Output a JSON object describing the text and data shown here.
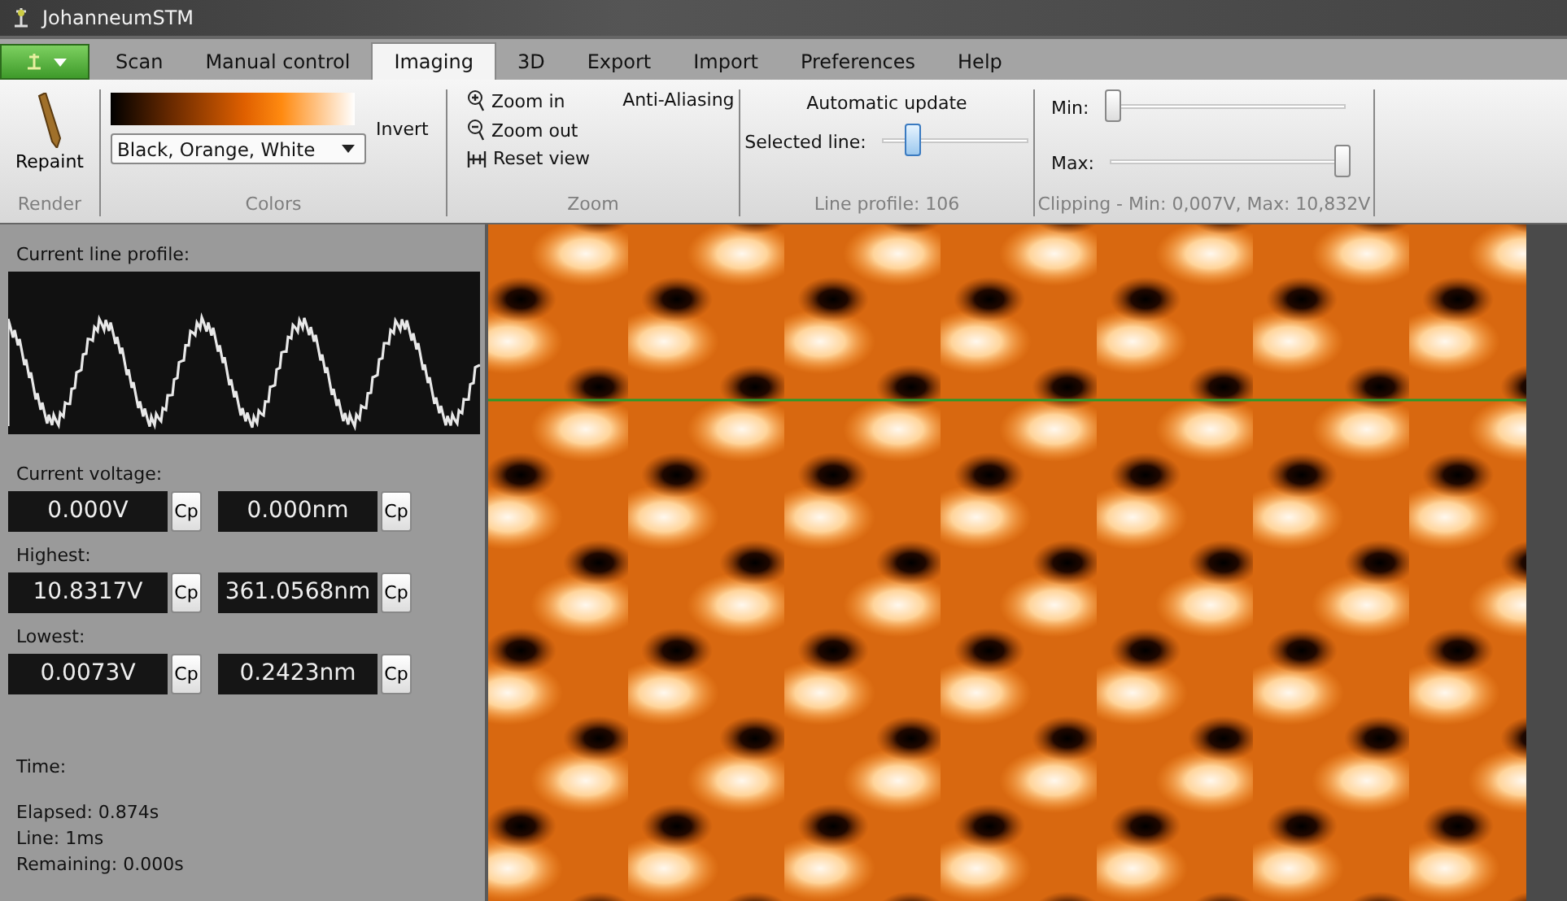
{
  "window": {
    "title": "JohanneumSTM"
  },
  "tabs": [
    {
      "label": "Scan",
      "selected": false
    },
    {
      "label": "Manual control",
      "selected": false
    },
    {
      "label": "Imaging",
      "selected": true
    },
    {
      "label": "3D",
      "selected": false
    },
    {
      "label": "Export",
      "selected": false
    },
    {
      "label": "Import",
      "selected": false
    },
    {
      "label": "Preferences",
      "selected": false
    },
    {
      "label": "Help",
      "selected": false
    }
  ],
  "ribbon": {
    "render": {
      "button": "Repaint",
      "caption": "Render"
    },
    "colors": {
      "palette": "Black, Orange, White",
      "invert": "Invert",
      "caption": "Colors"
    },
    "zoom": {
      "items": [
        {
          "kind": "zoom-in",
          "label": "Zoom in"
        },
        {
          "kind": "zoom-out",
          "label": "Zoom out"
        },
        {
          "kind": "reset",
          "label": "Reset view"
        }
      ],
      "anti_aliasing": "Anti-Aliasing",
      "caption": "Zoom"
    },
    "line_profile": {
      "automatic_update": "Automatic update",
      "label": "Selected line:",
      "level": 0.17,
      "caption": "Line profile: 106"
    },
    "clipping": {
      "sliders": [
        {
          "label": "Min:",
          "level": 0
        },
        {
          "label": "Max:",
          "level": 1
        }
      ],
      "caption": "Clipping - Min: 0,007V, Max: 10,832V"
    }
  },
  "panel": {
    "profile_label": "Current line profile:",
    "readouts": [
      {
        "label": "Current voltage:",
        "voltage": "0.000V",
        "height": "0.000nm",
        "copy": [
          "Cp",
          "Cp"
        ]
      },
      {
        "label": "Highest:",
        "voltage": "10.8317V",
        "height": "361.0568nm",
        "copy": [
          "Cp",
          "Cp"
        ]
      },
      {
        "label": "Lowest:",
        "voltage": "0.0073V",
        "height": "0.2423nm",
        "copy": [
          "Cp",
          "Cp"
        ]
      }
    ],
    "time_label": "Time:",
    "time_lines": [
      "Elapsed: 0.874s",
      "Line: 1ms",
      "Remaining: 0.000s"
    ]
  }
}
